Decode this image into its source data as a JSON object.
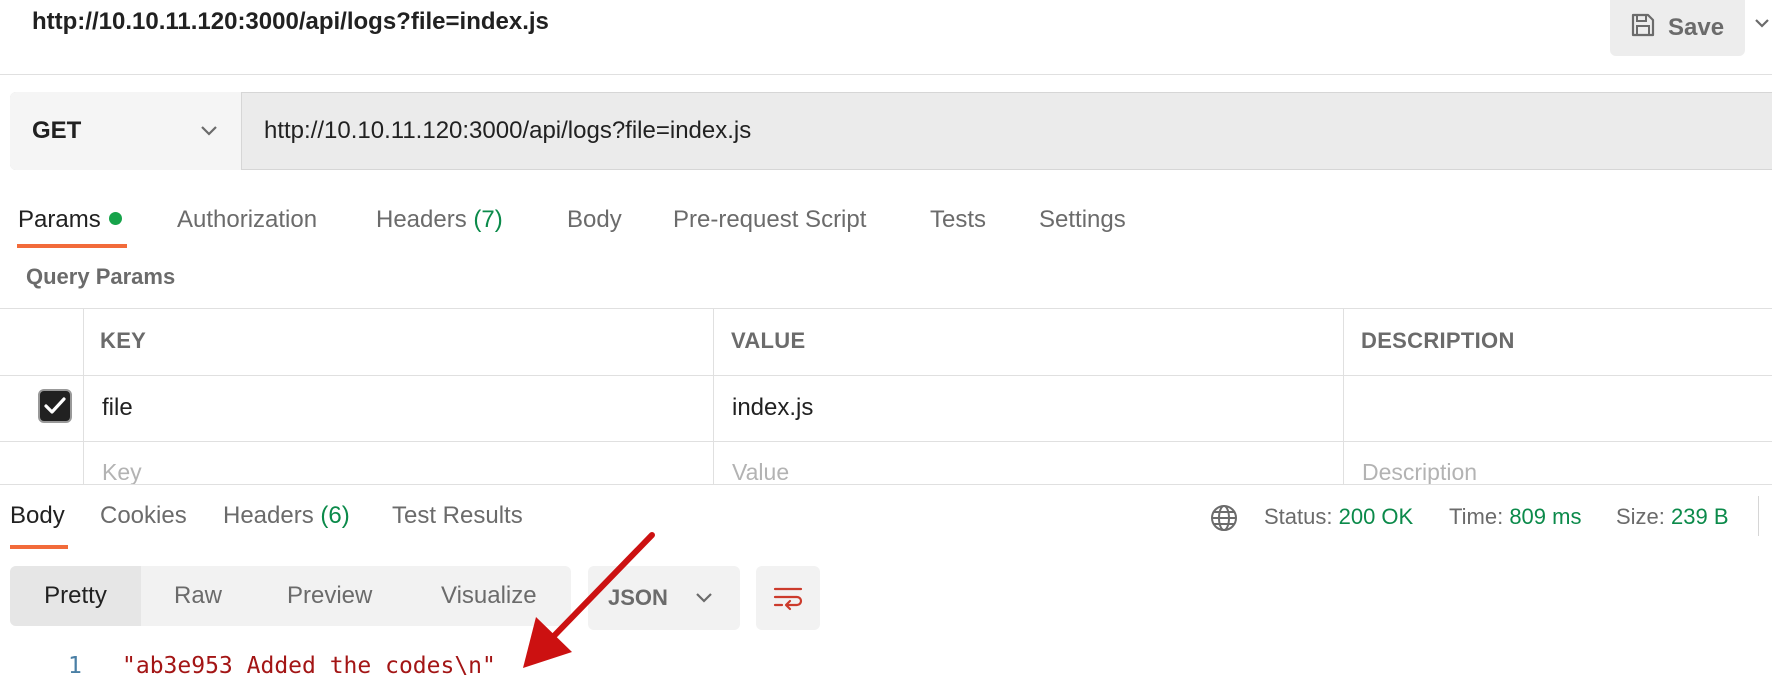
{
  "header": {
    "request_title": "http://10.10.11.120:3000/api/logs?file=index.js",
    "save_label": "Save",
    "save_icon": "floppy-disk-icon"
  },
  "request": {
    "method": "GET",
    "url": "http://10.10.11.120:3000/api/logs?file=index.js"
  },
  "request_tabs": {
    "params": "Params",
    "authorization": "Authorization",
    "headers": "Headers",
    "headers_count": "(7)",
    "body": "Body",
    "prerequest": "Pre-request Script",
    "tests": "Tests",
    "settings": "Settings",
    "active": "Params"
  },
  "query_params": {
    "section_label": "Query Params",
    "columns": [
      "KEY",
      "VALUE",
      "DESCRIPTION"
    ],
    "rows": [
      {
        "checked": true,
        "key": "file",
        "value": "index.js",
        "description": ""
      }
    ],
    "placeholders": {
      "key": "Key",
      "value": "Value",
      "description": "Description"
    }
  },
  "response_tabs": {
    "body": "Body",
    "cookies": "Cookies",
    "headers": "Headers",
    "headers_count": "(6)",
    "test_results": "Test Results",
    "active": "Body"
  },
  "response_status": {
    "status_label": "Status:",
    "status_value": "200 OK",
    "time_label": "Time:",
    "time_value": "809 ms",
    "size_label": "Size:",
    "size_value": "239 B"
  },
  "view_modes": {
    "pretty": "Pretty",
    "raw": "Raw",
    "preview": "Preview",
    "visualize": "Visualize",
    "active": "Pretty",
    "format": "JSON"
  },
  "response_body": {
    "lines": [
      {
        "number": "1",
        "text": "\"ab3e953 Added the codes\\n\""
      }
    ]
  },
  "colors": {
    "accent": "#f26b3a",
    "success": "#0b8a4a",
    "arrow": "#cc1111",
    "string": "#a31515"
  }
}
